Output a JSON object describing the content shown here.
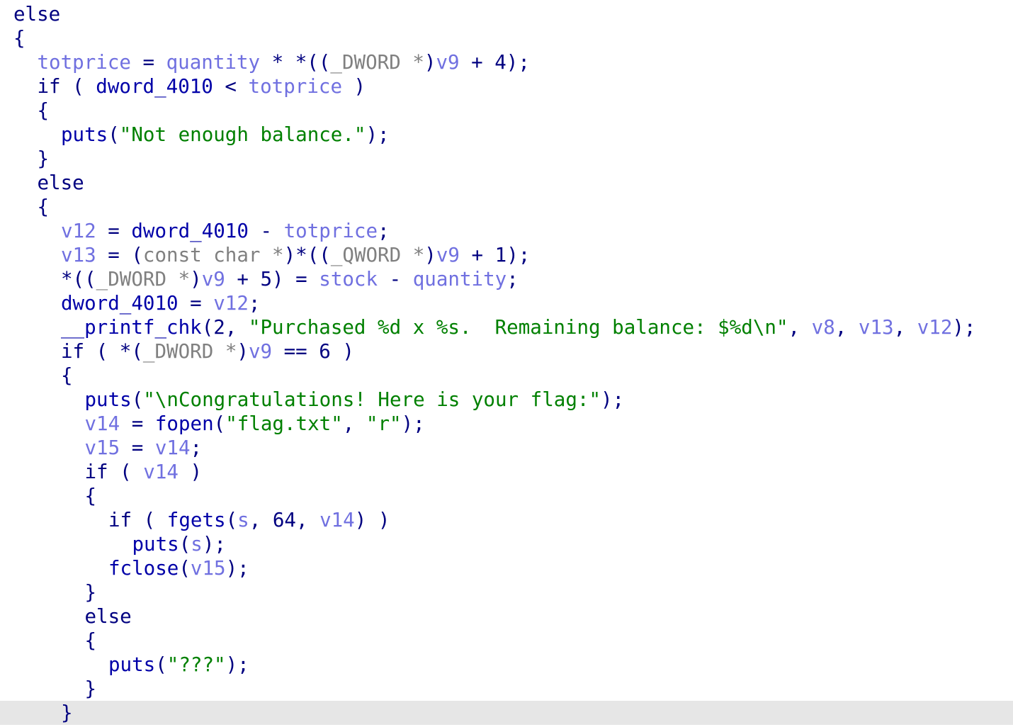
{
  "colors": {
    "background": "#ffffff",
    "keyword": "#000080",
    "function": "#0000a8",
    "variable": "#7070e0",
    "cast": "#808080",
    "string": "#008000",
    "punct": "#000080",
    "number": "#000080",
    "current_line_bg": "#e6e6e6"
  },
  "lines": [
    {
      "indent": 0,
      "highlight": false,
      "tokens": [
        {
          "t": "else",
          "c": "keyword"
        }
      ]
    },
    {
      "indent": 0,
      "highlight": false,
      "tokens": [
        {
          "t": "{",
          "c": "punct"
        }
      ]
    },
    {
      "indent": 1,
      "highlight": false,
      "tokens": [
        {
          "t": "totprice",
          "c": "variable"
        },
        {
          "t": " = ",
          "c": "punct"
        },
        {
          "t": "quantity",
          "c": "variable"
        },
        {
          "t": " * *((",
          "c": "punct"
        },
        {
          "t": "_DWORD *",
          "c": "cast"
        },
        {
          "t": ")",
          "c": "punct"
        },
        {
          "t": "v9",
          "c": "variable"
        },
        {
          "t": " + 4);",
          "c": "punct"
        }
      ]
    },
    {
      "indent": 1,
      "highlight": false,
      "tokens": [
        {
          "t": "if",
          "c": "keyword"
        },
        {
          "t": " ( ",
          "c": "punct"
        },
        {
          "t": "dword_4010",
          "c": "function"
        },
        {
          "t": " < ",
          "c": "punct"
        },
        {
          "t": "totprice",
          "c": "variable"
        },
        {
          "t": " )",
          "c": "punct"
        }
      ]
    },
    {
      "indent": 1,
      "highlight": false,
      "tokens": [
        {
          "t": "{",
          "c": "punct"
        }
      ]
    },
    {
      "indent": 2,
      "highlight": false,
      "tokens": [
        {
          "t": "puts",
          "c": "function"
        },
        {
          "t": "(",
          "c": "punct"
        },
        {
          "t": "\"Not enough balance.\"",
          "c": "string"
        },
        {
          "t": ");",
          "c": "punct"
        }
      ]
    },
    {
      "indent": 1,
      "highlight": false,
      "tokens": [
        {
          "t": "}",
          "c": "punct"
        }
      ]
    },
    {
      "indent": 1,
      "highlight": false,
      "tokens": [
        {
          "t": "else",
          "c": "keyword"
        }
      ]
    },
    {
      "indent": 1,
      "highlight": false,
      "tokens": [
        {
          "t": "{",
          "c": "punct"
        }
      ]
    },
    {
      "indent": 2,
      "highlight": false,
      "tokens": [
        {
          "t": "v12",
          "c": "variable"
        },
        {
          "t": " = ",
          "c": "punct"
        },
        {
          "t": "dword_4010",
          "c": "function"
        },
        {
          "t": " - ",
          "c": "punct"
        },
        {
          "t": "totprice",
          "c": "variable"
        },
        {
          "t": ";",
          "c": "punct"
        }
      ]
    },
    {
      "indent": 2,
      "highlight": false,
      "tokens": [
        {
          "t": "v13",
          "c": "variable"
        },
        {
          "t": " = (",
          "c": "punct"
        },
        {
          "t": "const char *",
          "c": "cast"
        },
        {
          "t": ")*((",
          "c": "punct"
        },
        {
          "t": "_QWORD *",
          "c": "cast"
        },
        {
          "t": ")",
          "c": "punct"
        },
        {
          "t": "v9",
          "c": "variable"
        },
        {
          "t": " + 1);",
          "c": "punct"
        }
      ]
    },
    {
      "indent": 2,
      "highlight": false,
      "tokens": [
        {
          "t": "*((",
          "c": "punct"
        },
        {
          "t": "_DWORD *",
          "c": "cast"
        },
        {
          "t": ")",
          "c": "punct"
        },
        {
          "t": "v9",
          "c": "variable"
        },
        {
          "t": " + 5) = ",
          "c": "punct"
        },
        {
          "t": "stock",
          "c": "variable"
        },
        {
          "t": " - ",
          "c": "punct"
        },
        {
          "t": "quantity",
          "c": "variable"
        },
        {
          "t": ";",
          "c": "punct"
        }
      ]
    },
    {
      "indent": 2,
      "highlight": false,
      "tokens": [
        {
          "t": "dword_4010",
          "c": "function"
        },
        {
          "t": " = ",
          "c": "punct"
        },
        {
          "t": "v12",
          "c": "variable"
        },
        {
          "t": ";",
          "c": "punct"
        }
      ]
    },
    {
      "indent": 2,
      "highlight": false,
      "tokens": [
        {
          "t": "__printf_chk",
          "c": "function"
        },
        {
          "t": "(2, ",
          "c": "punct"
        },
        {
          "t": "\"Purchased %d x %s.  Remaining balance: $%d\\n\"",
          "c": "string"
        },
        {
          "t": ", ",
          "c": "punct"
        },
        {
          "t": "v8",
          "c": "variable"
        },
        {
          "t": ", ",
          "c": "punct"
        },
        {
          "t": "v13",
          "c": "variable"
        },
        {
          "t": ", ",
          "c": "punct"
        },
        {
          "t": "v12",
          "c": "variable"
        },
        {
          "t": ");",
          "c": "punct"
        }
      ]
    },
    {
      "indent": 2,
      "highlight": false,
      "tokens": [
        {
          "t": "if",
          "c": "keyword"
        },
        {
          "t": " ( *(",
          "c": "punct"
        },
        {
          "t": "_DWORD *",
          "c": "cast"
        },
        {
          "t": ")",
          "c": "punct"
        },
        {
          "t": "v9",
          "c": "variable"
        },
        {
          "t": " == 6 )",
          "c": "punct"
        }
      ]
    },
    {
      "indent": 2,
      "highlight": false,
      "tokens": [
        {
          "t": "{",
          "c": "punct"
        }
      ]
    },
    {
      "indent": 3,
      "highlight": false,
      "tokens": [
        {
          "t": "puts",
          "c": "function"
        },
        {
          "t": "(",
          "c": "punct"
        },
        {
          "t": "\"\\nCongratulations! Here is your flag:\"",
          "c": "string"
        },
        {
          "t": ");",
          "c": "punct"
        }
      ]
    },
    {
      "indent": 3,
      "highlight": false,
      "tokens": [
        {
          "t": "v14",
          "c": "variable"
        },
        {
          "t": " = ",
          "c": "punct"
        },
        {
          "t": "fopen",
          "c": "function"
        },
        {
          "t": "(",
          "c": "punct"
        },
        {
          "t": "\"flag.txt\"",
          "c": "string"
        },
        {
          "t": ", ",
          "c": "punct"
        },
        {
          "t": "\"r\"",
          "c": "string"
        },
        {
          "t": ");",
          "c": "punct"
        }
      ]
    },
    {
      "indent": 3,
      "highlight": false,
      "tokens": [
        {
          "t": "v15",
          "c": "variable"
        },
        {
          "t": " = ",
          "c": "punct"
        },
        {
          "t": "v14",
          "c": "variable"
        },
        {
          "t": ";",
          "c": "punct"
        }
      ]
    },
    {
      "indent": 3,
      "highlight": false,
      "tokens": [
        {
          "t": "if",
          "c": "keyword"
        },
        {
          "t": " ( ",
          "c": "punct"
        },
        {
          "t": "v14",
          "c": "variable"
        },
        {
          "t": " )",
          "c": "punct"
        }
      ]
    },
    {
      "indent": 3,
      "highlight": false,
      "tokens": [
        {
          "t": "{",
          "c": "punct"
        }
      ]
    },
    {
      "indent": 4,
      "highlight": false,
      "tokens": [
        {
          "t": "if",
          "c": "keyword"
        },
        {
          "t": " ( ",
          "c": "punct"
        },
        {
          "t": "fgets",
          "c": "function"
        },
        {
          "t": "(",
          "c": "punct"
        },
        {
          "t": "s",
          "c": "variable"
        },
        {
          "t": ", 64, ",
          "c": "punct"
        },
        {
          "t": "v14",
          "c": "variable"
        },
        {
          "t": ") )",
          "c": "punct"
        }
      ]
    },
    {
      "indent": 5,
      "highlight": false,
      "tokens": [
        {
          "t": "puts",
          "c": "function"
        },
        {
          "t": "(",
          "c": "punct"
        },
        {
          "t": "s",
          "c": "variable"
        },
        {
          "t": ");",
          "c": "punct"
        }
      ]
    },
    {
      "indent": 4,
      "highlight": false,
      "tokens": [
        {
          "t": "fclose",
          "c": "function"
        },
        {
          "t": "(",
          "c": "punct"
        },
        {
          "t": "v15",
          "c": "variable"
        },
        {
          "t": ");",
          "c": "punct"
        }
      ]
    },
    {
      "indent": 3,
      "highlight": false,
      "tokens": [
        {
          "t": "}",
          "c": "punct"
        }
      ]
    },
    {
      "indent": 3,
      "highlight": false,
      "tokens": [
        {
          "t": "else",
          "c": "keyword"
        }
      ]
    },
    {
      "indent": 3,
      "highlight": false,
      "tokens": [
        {
          "t": "{",
          "c": "punct"
        }
      ]
    },
    {
      "indent": 4,
      "highlight": false,
      "tokens": [
        {
          "t": "puts",
          "c": "function"
        },
        {
          "t": "(",
          "c": "punct"
        },
        {
          "t": "\"???\"",
          "c": "string"
        },
        {
          "t": ");",
          "c": "punct"
        }
      ]
    },
    {
      "indent": 3,
      "highlight": false,
      "tokens": [
        {
          "t": "}",
          "c": "punct"
        }
      ]
    },
    {
      "indent": 2,
      "highlight": true,
      "tokens": [
        {
          "t": "}",
          "c": "punct"
        }
      ]
    }
  ]
}
